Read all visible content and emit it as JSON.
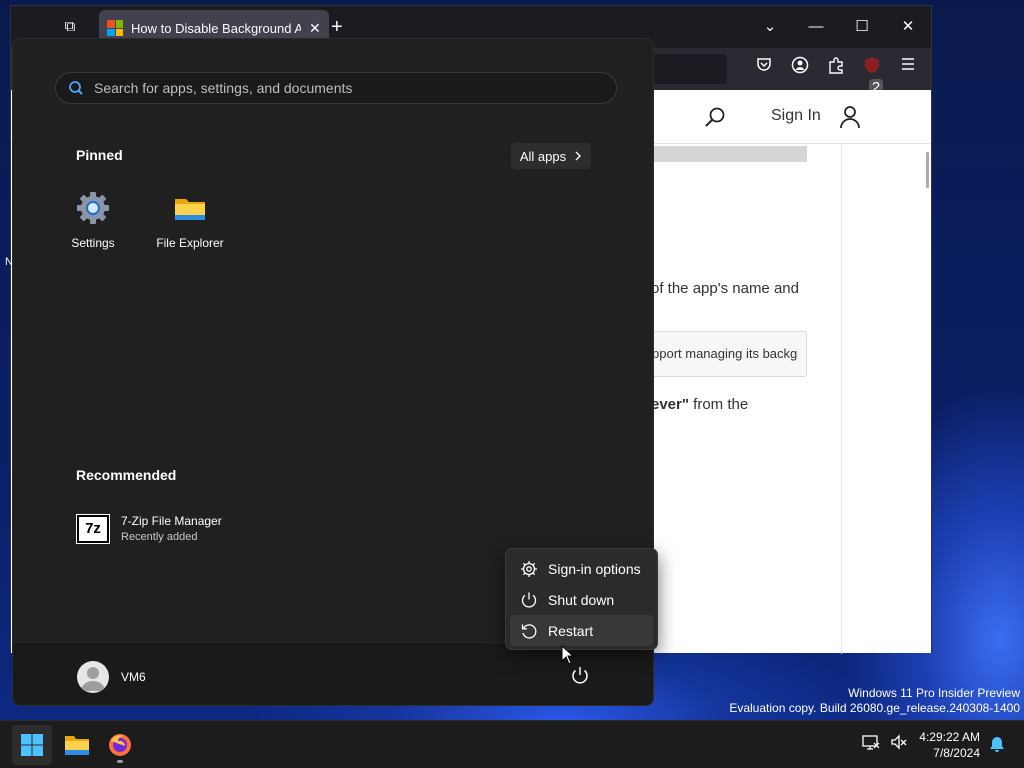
{
  "browser": {
    "tab_title": "How to Disable Background Ap",
    "newtab_symbol": "+",
    "tabs_list_symbol": "⧉",
    "tab_close_symbol": "✕",
    "extension_badge": "2",
    "icons": [
      "pocket-icon",
      "account-icon",
      "extensions-icon",
      "ublock-icon",
      "menu-icon"
    ]
  },
  "window_controls": {
    "dropdown": "⌄",
    "minimize": "—",
    "maximize": "☐",
    "close": "✕"
  },
  "webpage": {
    "sign_in": "Sign In",
    "text_1": "of the app's name and",
    "note": "pport managing its backg",
    "text_2_bold": "ever\"",
    "text_2": " from the",
    "left_fragment": "N"
  },
  "start_menu": {
    "search_placeholder": "Search for apps, settings, and documents",
    "pinned_title": "Pinned",
    "all_apps_label": "All apps",
    "pinned": [
      {
        "label": "Settings",
        "icon": "settings-gear-icon"
      },
      {
        "label": "File Explorer",
        "icon": "folder-icon"
      }
    ],
    "recommended_title": "Recommended",
    "recommended": [
      {
        "name": "7-Zip File Manager",
        "sub": "Recently added",
        "icon_text": "7z"
      }
    ],
    "user_name": "VM6"
  },
  "power_menu": {
    "items": [
      {
        "label": "Sign-in options",
        "icon": "gear-icon"
      },
      {
        "label": "Shut down",
        "icon": "power-icon"
      },
      {
        "label": "Restart",
        "icon": "restart-icon",
        "hover": true
      }
    ]
  },
  "watermark": {
    "line1": "Windows 11 Pro Insider Preview",
    "line2": "Evaluation copy. Build 26080.ge_release.240308-1400"
  },
  "taskbar": {
    "time": "4:29:22 AM",
    "date": "7/8/2024",
    "apps": [
      "start-button",
      "file-explorer",
      "firefox"
    ]
  },
  "colors": {
    "accent": "#3b82f6",
    "start_bg": "#202020",
    "flyout_bg": "#2b2b2b",
    "taskbar_bg": "#1c1c1c"
  }
}
